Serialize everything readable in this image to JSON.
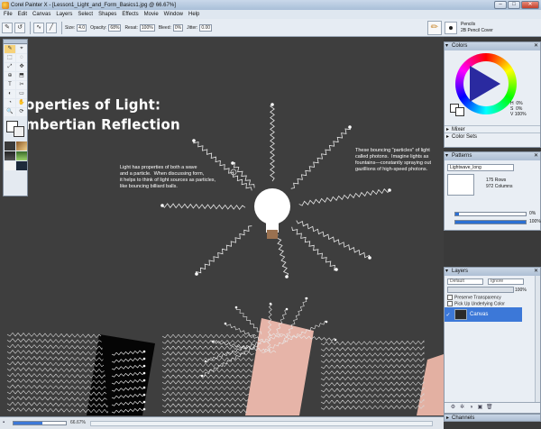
{
  "window": {
    "title": "Corel Painter X - [Lesson1_Light_and_Form_Basics1.jpg @ 66.67%]",
    "minimize": "–",
    "maximize": "□",
    "close": "✕"
  },
  "menu": [
    "File",
    "Edit",
    "Canvas",
    "Layers",
    "Select",
    "Shapes",
    "Effects",
    "Movie",
    "Window",
    "Help"
  ],
  "property_bar": {
    "size_label": "Size:",
    "size_value": "4.0",
    "opacity_label": "Opacity:",
    "opacity_value": "68%",
    "resat_label": "Resat:",
    "resat_value": "100%",
    "bleed_label": "Bleed:",
    "bleed_value": "0%",
    "jitter_label": "Jitter:",
    "jitter_value": "0.00"
  },
  "brush_selector": {
    "category": "Pencils",
    "variant": "2B Pencil Cover"
  },
  "toolbox": {
    "tools": [
      "✎",
      "⌖",
      "⬚",
      "◌",
      "⤢",
      "✥",
      "⊕",
      "⬒",
      "T",
      "✂",
      "◐",
      "▭",
      "◔",
      "✋",
      "🔍",
      "⟳"
    ]
  },
  "document": {
    "heading": "operties of Light:\nmbertian Reflection",
    "note_left": "Light has properties of both a wave\nand a particle.  When discussing form,\nit helps to think of light sources as particles,\nlike bouncing billiard balls.",
    "note_right": "These bouncing \"particles\" of light\ncalled photons.  Imagine lights as\nfountains—constantly spraying out\ngazillions of high-speed photons."
  },
  "panels": {
    "colors": {
      "title": "Colors",
      "values": "H  0%\nS  0%\nV 100%",
      "mixer_label": "Mixer",
      "color_sets_label": "Color Sets"
    },
    "patterns": {
      "title": "Patterns",
      "pattern_name": "Lightwave_long",
      "rows": "175 Rows",
      "columns": "972 Columns",
      "slider1": "0%",
      "slider2": "100%",
      "slider1_level": 0.05,
      "slider2_level": 1.0
    },
    "layers": {
      "title": "Layers",
      "composite_method": "Default",
      "composite_depth": "Ignore",
      "opacity": "100%",
      "preserve_transparency": "Preserve Transparency",
      "pick_up_color": "Pick Up Underlying Color",
      "layer_name": "Canvas"
    },
    "channels": {
      "title": "Channels"
    }
  },
  "status": {
    "zoom": "66.67%",
    "zoom_level": 0.55
  },
  "colors": {
    "accent": "#3c78d8",
    "canvas_bg": "#3e3e3e",
    "card_pink": "#e6b4a8"
  }
}
